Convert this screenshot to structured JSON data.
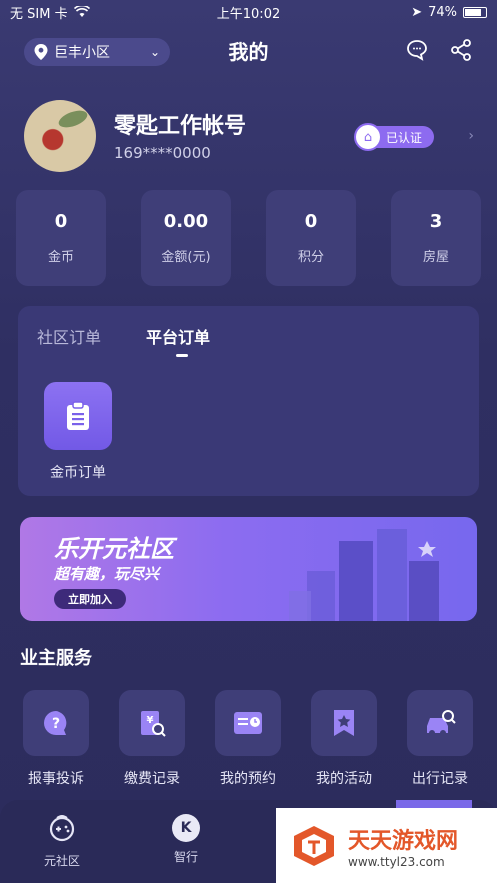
{
  "status": {
    "carrier": "无 SIM 卡",
    "time": "上午10:02",
    "battery": "74%"
  },
  "nav": {
    "community": "巨丰小区",
    "title": "我的"
  },
  "profile": {
    "name": "零匙工作帐号",
    "phone": "169****0000",
    "verified": "已认证"
  },
  "stats": [
    {
      "value": "0",
      "label": "金币"
    },
    {
      "value": "0.00",
      "label": "金额(元)"
    },
    {
      "value": "0",
      "label": "积分"
    },
    {
      "value": "3",
      "label": "房屋"
    }
  ],
  "orders": {
    "tabs": [
      "社区订单",
      "平台订单"
    ],
    "item": "金币订单"
  },
  "banner": {
    "title": "乐开元社区",
    "subtitle": "超有趣，玩尽兴",
    "button": "立即加入"
  },
  "services": {
    "title": "业主服务",
    "items": [
      {
        "label": "报事投诉",
        "icon": "question-bubble-icon"
      },
      {
        "label": "缴费记录",
        "icon": "bill-search-icon"
      },
      {
        "label": "我的预约",
        "icon": "appointment-card-icon"
      },
      {
        "label": "我的活动",
        "icon": "star-bookmark-icon"
      },
      {
        "label": "出行记录",
        "icon": "car-search-icon"
      }
    ]
  },
  "tabbar": {
    "items": [
      {
        "label": "元社区"
      },
      {
        "label": "智行"
      }
    ],
    "k_letter": "K"
  },
  "watermark": {
    "title": "天天游戏网",
    "url": "www.ttyl23.com"
  }
}
